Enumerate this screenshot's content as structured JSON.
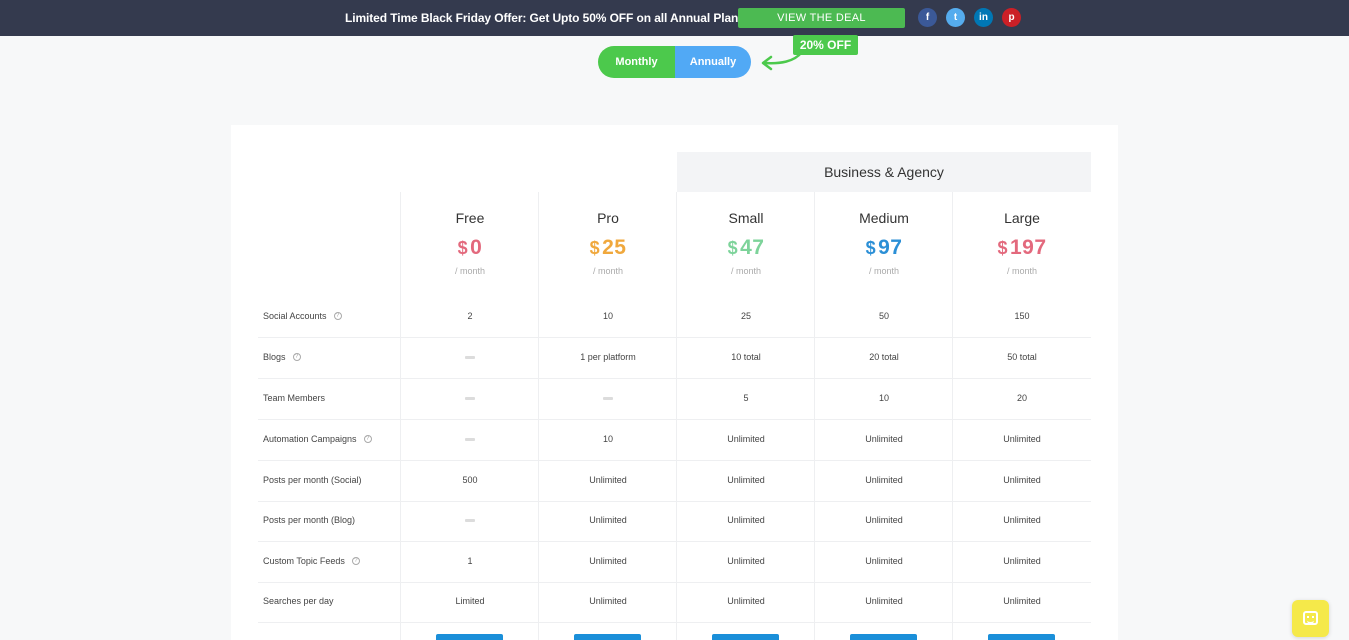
{
  "banner": {
    "text": "Limited Time Black Friday Offer: Get Upto 50% OFF on all Annual Plans!",
    "button": "VIEW THE DEAL",
    "social": [
      {
        "icon": "facebook-icon",
        "glyph": "f"
      },
      {
        "icon": "twitter-icon",
        "glyph": "t"
      },
      {
        "icon": "linkedin-icon",
        "glyph": "in"
      },
      {
        "icon": "pinterest-icon",
        "glyph": "p"
      }
    ]
  },
  "billing": {
    "monthly": "Monthly",
    "annually": "Annually",
    "discount": "20% OFF"
  },
  "group_heading": "Business & Agency",
  "plans": [
    {
      "name": "Free",
      "currency": "$",
      "price": "0",
      "period": "/ month",
      "color": "#e3697d"
    },
    {
      "name": "Pro",
      "currency": "$",
      "price": "25",
      "period": "/ month",
      "color": "#f0a83d"
    },
    {
      "name": "Small",
      "currency": "$",
      "price": "47",
      "period": "/ month",
      "color": "#7dd39a"
    },
    {
      "name": "Medium",
      "currency": "$",
      "price": "97",
      "period": "/ month",
      "color": "#2b8fd6"
    },
    {
      "name": "Large",
      "currency": "$",
      "price": "197",
      "period": "/ month",
      "color": "#e3697d"
    }
  ],
  "features": [
    {
      "label": "Social Accounts",
      "help": true,
      "values": [
        "2",
        "10",
        "25",
        "50",
        "150"
      ]
    },
    {
      "label": "Blogs",
      "help": true,
      "values": [
        "-",
        "1 per platform",
        "10 total",
        "20 total",
        "50 total"
      ]
    },
    {
      "label": "Team Members",
      "help": false,
      "values": [
        "-",
        "-",
        "5",
        "10",
        "20"
      ]
    },
    {
      "label": "Automation Campaigns",
      "help": true,
      "values": [
        "-",
        "10",
        "Unlimited",
        "Unlimited",
        "Unlimited"
      ]
    },
    {
      "label": "Posts per month (Social)",
      "help": false,
      "values": [
        "500",
        "Unlimited",
        "Unlimited",
        "Unlimited",
        "Unlimited"
      ]
    },
    {
      "label": "Posts per month (Blog)",
      "help": false,
      "values": [
        "-",
        "Unlimited",
        "Unlimited",
        "Unlimited",
        "Unlimited"
      ]
    },
    {
      "label": "Custom Topic Feeds",
      "help": true,
      "values": [
        "1",
        "Unlimited",
        "Unlimited",
        "Unlimited",
        "Unlimited"
      ]
    },
    {
      "label": "Searches per day",
      "help": false,
      "values": [
        "Limited",
        "Unlimited",
        "Unlimited",
        "Unlimited",
        "Unlimited"
      ]
    }
  ],
  "chat_widget": {
    "icon": "chat-icon"
  }
}
